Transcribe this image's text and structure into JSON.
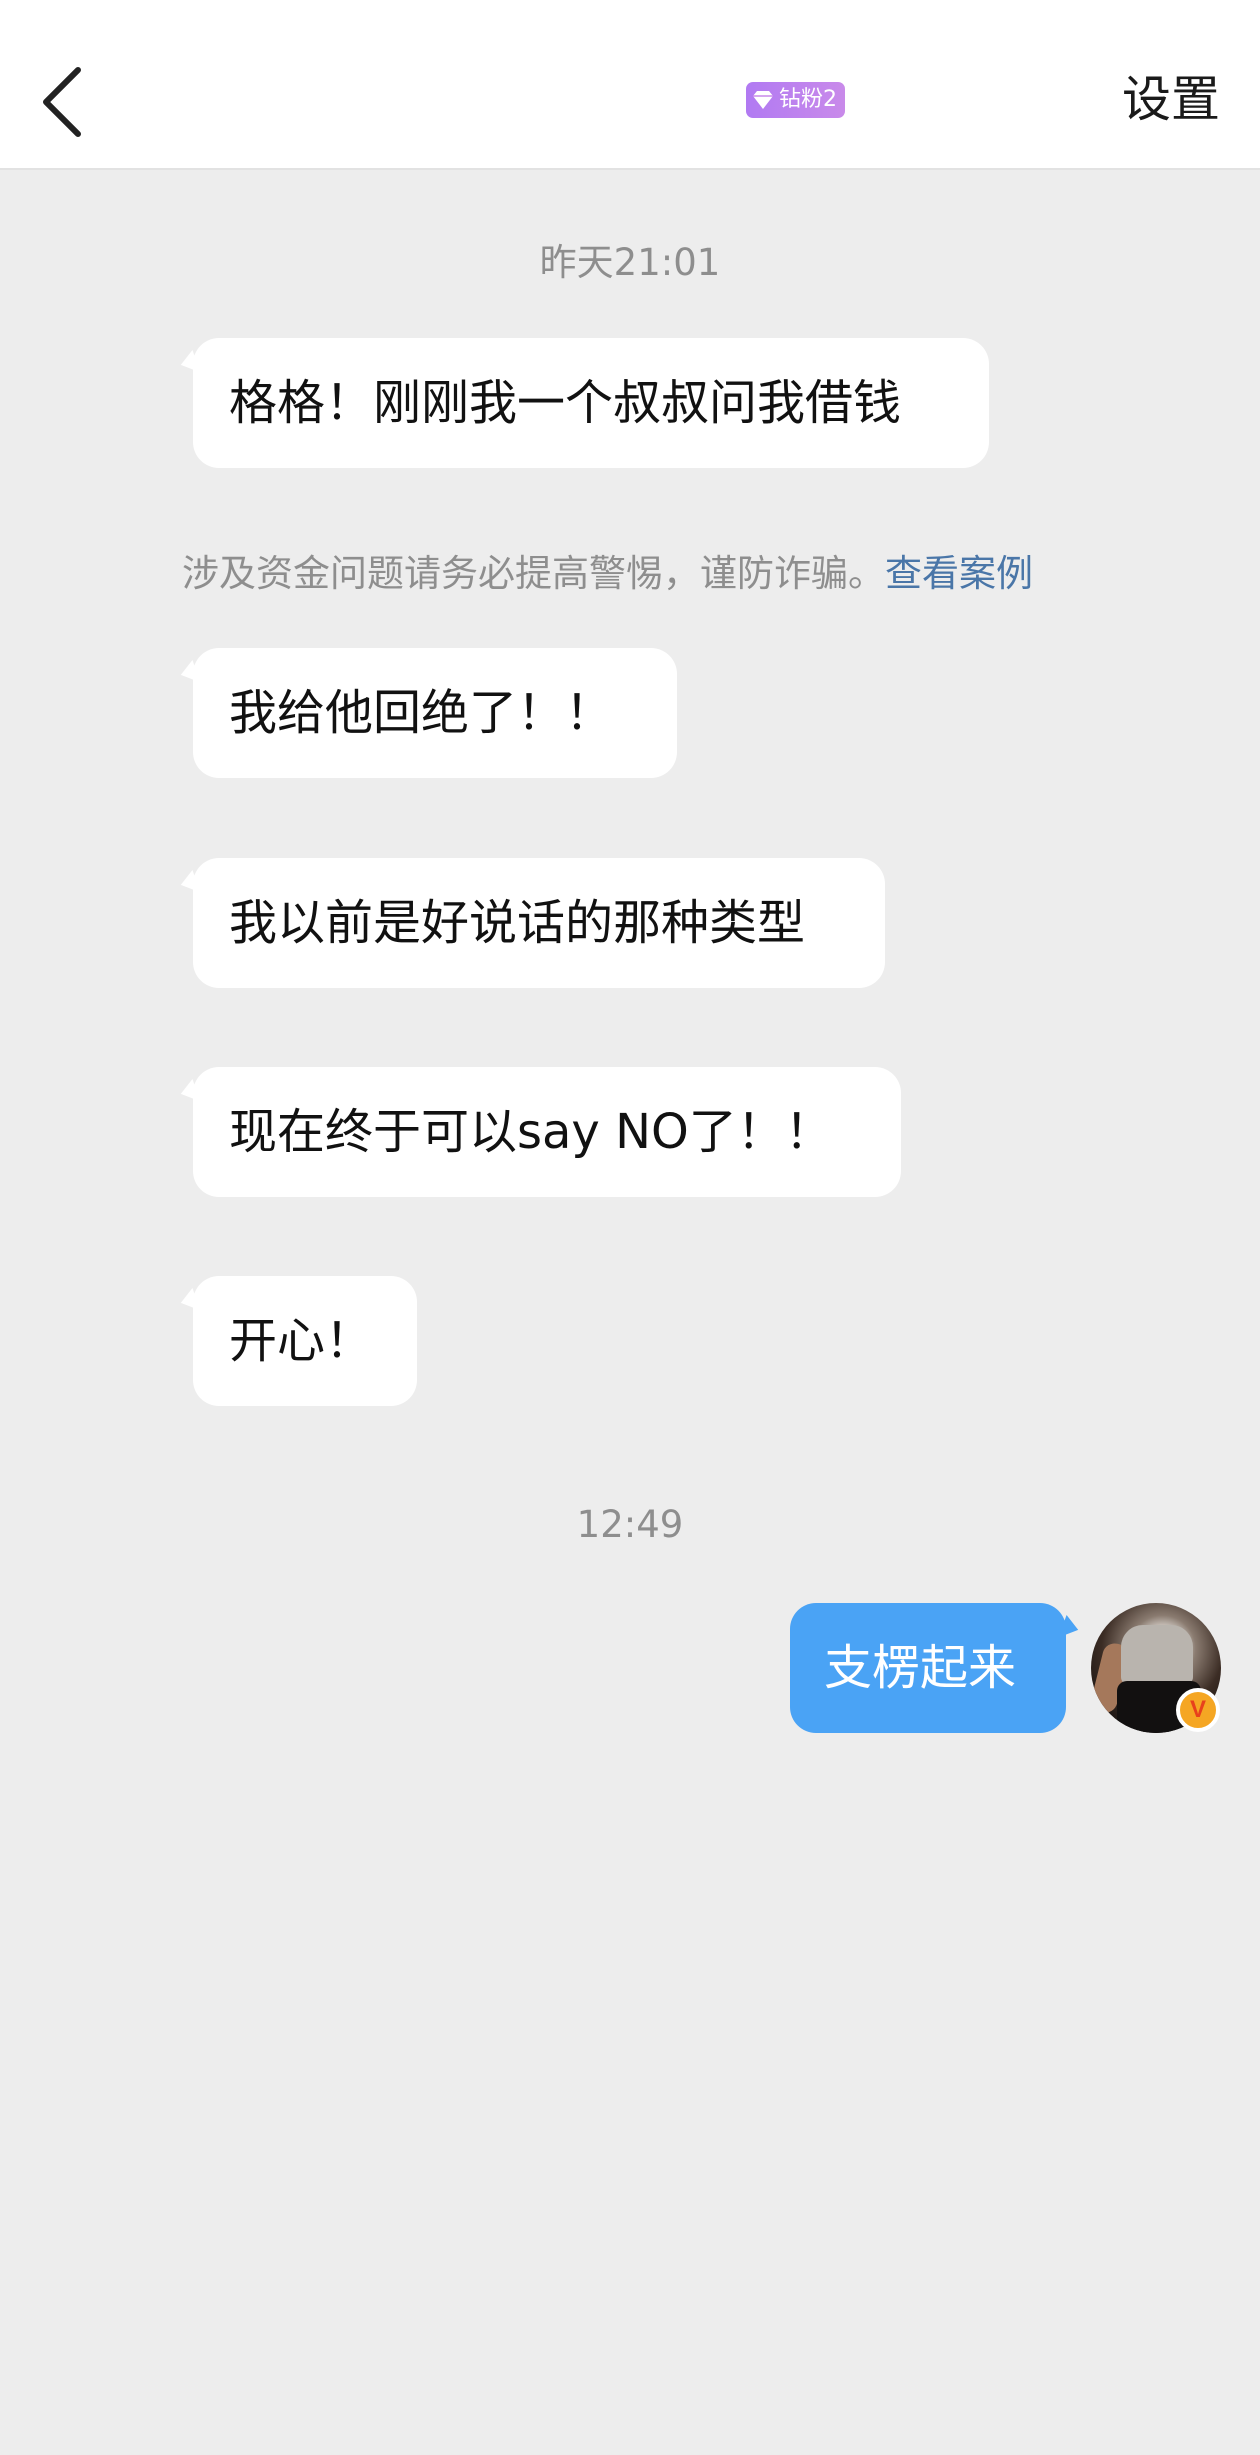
{
  "header": {
    "back_icon": "chevron-left-icon",
    "fan_badge": {
      "icon": "diamond-icon",
      "label": "钻粉2",
      "color": "#b17af2"
    },
    "settings_label": "设置"
  },
  "chat": {
    "timestamps": [
      "昨天21:01",
      "12:49"
    ],
    "received": [
      {
        "text": "格格！刚刚我一个叔叔问我借钱"
      },
      {
        "text": "我给他回绝了！！"
      },
      {
        "text": "我以前是好说话的那种类型"
      },
      {
        "text": "现在终于可以say NO了！！"
      },
      {
        "text": "开心！"
      }
    ],
    "warning": {
      "text": "涉及资金问题请务必提高警惕，谨防诈骗。",
      "link": "查看案例"
    },
    "sent": [
      {
        "text": "支楞起来"
      }
    ],
    "self_avatar": {
      "icon": "user-avatar",
      "verified_badge": "V"
    }
  },
  "colors": {
    "background": "#ededed",
    "sent_bubble": "#4aa3f5",
    "received_bubble": "#ffffff",
    "link": "#4a76a8",
    "verified_badge": "#f5a623"
  }
}
